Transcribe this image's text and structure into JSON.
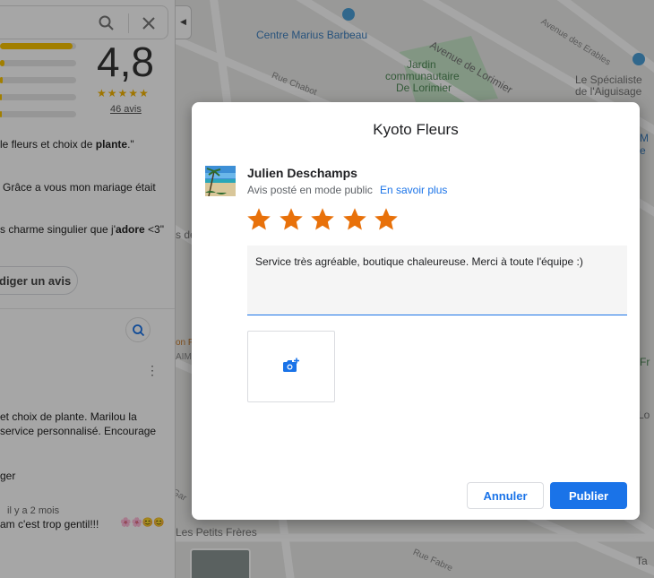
{
  "side_panel": {
    "rating_value": "4,8",
    "rating_stars": "★★★★★",
    "review_count": "46 avis",
    "rating_distribution": [
      0.95,
      0.06,
      0.03,
      0.02,
      0.02
    ],
    "snippets": [
      {
        "pre": "le fleurs et choix de ",
        "bold": "plante",
        "post": ".\""
      },
      {
        "pre": "Grâce a vous mon mariage était",
        "bold": "",
        "post": ""
      },
      {
        "pre": "s charme singulier que j'",
        "bold": "adore",
        "post": " <3\""
      }
    ],
    "write_review_label": "diger un avis",
    "review_text_line1": "et choix de plante. Marilou la",
    "review_text_line2": "service personnalisé. Encourage",
    "review_text_line3": "ger",
    "review_date": "il y a 2 mois",
    "review_reply": "am c'est trop gentil!!!",
    "reply_emojis": "🌸🌸😊😊",
    "kebab": "⋮",
    "collapse_arrow": "◀"
  },
  "map": {
    "labels": {
      "centre": "Centre Marius Barbeau",
      "jardin_1": "Jardin",
      "jardin_2": "communautaire",
      "jardin_3": "De Lorimier",
      "lorimier": "Avenue de Lorimier",
      "chabot": "Rue Chabot",
      "erables": "Avenue des Erables",
      "aiguisage_1": "Le Spécialiste",
      "aiguisage_2": "de l'Aiguisage",
      "petits_freres": "Les Petits Frères",
      "fabre": "Rue Fabre",
      "right_m": "M",
      "right_e": "e",
      "right_lo": "Lo",
      "right_ta": "Ta",
      "right_fr": "Fr",
      "left_de": "s de",
      "left_on": "on F",
      "left_aim": "AIM",
      "left_gan": "Gar"
    }
  },
  "dialog": {
    "title": "Kyoto Fleurs",
    "user_name": "Julien Deschamps",
    "post_mode": "Avis posté en mode public",
    "learn_more": "En savoir plus",
    "rating": 5,
    "max_rating": 5,
    "review_text": "Service très agréable, boutique chaleureuse. Merci à toute l'équipe :)",
    "cancel_label": "Annuler",
    "publish_label": "Publier"
  },
  "colors": {
    "accent": "#1a73e8",
    "star": "#e8710a",
    "panel_star": "#f4b400"
  }
}
